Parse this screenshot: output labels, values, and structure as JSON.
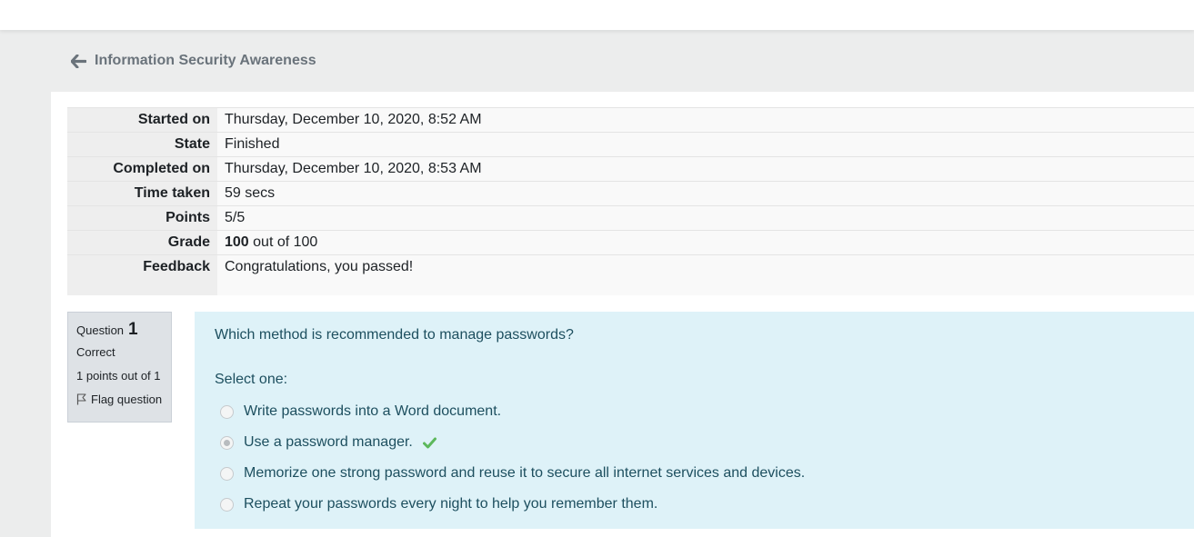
{
  "header": {
    "title": "Information Security Awareness"
  },
  "summary": {
    "rows": [
      {
        "label": "Started on",
        "value": "Thursday, December 10, 2020, 8:52 AM"
      },
      {
        "label": "State",
        "value": "Finished"
      },
      {
        "label": "Completed on",
        "value": "Thursday, December 10, 2020, 8:53 AM"
      },
      {
        "label": "Time taken",
        "value": "59 secs"
      },
      {
        "label": "Points",
        "value": "5/5"
      },
      {
        "label": "Grade",
        "value_bold": "100",
        "value_rest": " out of 100"
      },
      {
        "label": "Feedback",
        "value": "Congratulations, you passed!"
      }
    ]
  },
  "question": {
    "label": "Question",
    "number": "1",
    "status": "Correct",
    "points": "1 points out of 1",
    "flag_label": "Flag question",
    "text": "Which method is recommended to manage passwords?",
    "prompt": "Select one:",
    "answers": [
      {
        "text": "Write passwords into a Word document.",
        "selected": false
      },
      {
        "text": "Use a password manager.",
        "selected": true,
        "correct": true
      },
      {
        "text": "Memorize one strong password and reuse it to secure all internet services and devices.",
        "selected": false
      },
      {
        "text": "Repeat your passwords every night to help you remember them.",
        "selected": false
      }
    ]
  },
  "icons": {
    "back": "arrow-left-icon",
    "flag": "flag-icon",
    "correct": "check-icon"
  },
  "colors": {
    "correct_check": "#5cb85c",
    "question_bg": "#def2f8"
  }
}
